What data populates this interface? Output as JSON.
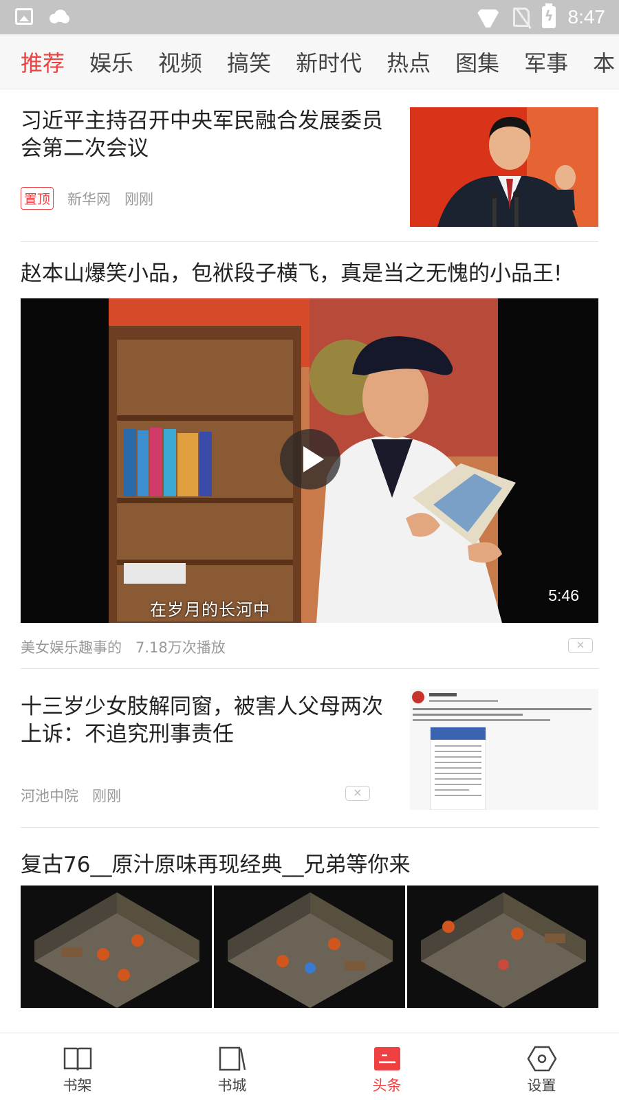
{
  "status_bar": {
    "time": "8:47",
    "icons": [
      "image-icon",
      "weather-icon",
      "wifi-icon",
      "no-sim-icon",
      "battery-charging-icon"
    ]
  },
  "tabs": [
    {
      "label": "推荐",
      "active": true
    },
    {
      "label": "娱乐",
      "active": false
    },
    {
      "label": "视频",
      "active": false
    },
    {
      "label": "搞笑",
      "active": false
    },
    {
      "label": "新时代",
      "active": false
    },
    {
      "label": "热点",
      "active": false
    },
    {
      "label": "图集",
      "active": false
    },
    {
      "label": "军事",
      "active": false
    },
    {
      "label": "本",
      "active": false
    }
  ],
  "feed": {
    "articles": [
      {
        "title": "习近平主持召开中央军民融合发展委员会第二次会议",
        "tag": "置顶",
        "source": "新华网",
        "time": "刚刚"
      },
      {
        "title": "赵本山爆笑小品，包袱段子横飞，真是当之无愧的小品王!",
        "video_subtitle": "在岁月的长河中",
        "duration": "5:46",
        "source": "美女娱乐趣事的",
        "plays": "7.18万次播放",
        "close": "×"
      },
      {
        "title": "十三岁少女肢解同窗，被害人父母两次上诉：不追究刑事责任",
        "source": "河池中院",
        "time": "刚刚",
        "close": "×"
      },
      {
        "title": "复古76__原汁原味再现经典__兄弟等你来"
      }
    ]
  },
  "bottom_nav": [
    {
      "label": "书架",
      "icon": "open-book-icon",
      "active": false
    },
    {
      "label": "书城",
      "icon": "bookstore-icon",
      "active": false
    },
    {
      "label": "头条",
      "icon": "headlines-icon",
      "active": true
    },
    {
      "label": "设置",
      "icon": "settings-hexagon-icon",
      "active": false
    }
  ],
  "colors": {
    "accent": "#f04142",
    "status_bar": "#c4c4c4",
    "tab_bar": "#f7f7f7"
  }
}
